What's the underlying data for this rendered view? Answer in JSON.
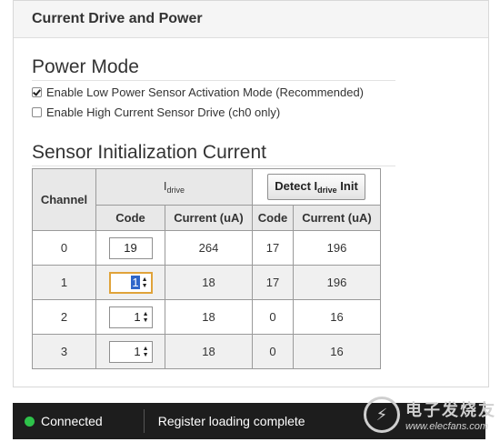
{
  "panel": {
    "title": "Current Drive and Power"
  },
  "power_mode": {
    "title": "Power Mode",
    "options": [
      {
        "label": "Enable Low Power Sensor Activation Mode (Recommended)",
        "checked": true
      },
      {
        "label": "Enable High Current Sensor Drive (ch0 only)",
        "checked": false
      }
    ]
  },
  "sensor_init": {
    "title": "Sensor Initialization Current",
    "table": {
      "channel_header": "Channel",
      "idrive_header": {
        "main": "I",
        "sub": "drive"
      },
      "detect_button": {
        "pre": "Detect I",
        "sub": "drive",
        "post": " Init"
      },
      "col_code": "Code",
      "col_current": "Current (uA)",
      "rows": [
        {
          "channel": "0",
          "code": "19",
          "current": "264",
          "detect_code": "17",
          "detect_current": "196"
        },
        {
          "channel": "1",
          "code": "1",
          "current": "18",
          "detect_code": "17",
          "detect_current": "196"
        },
        {
          "channel": "2",
          "code": "1",
          "current": "18",
          "detect_code": "0",
          "detect_current": "16"
        },
        {
          "channel": "3",
          "code": "1",
          "current": "18",
          "detect_code": "0",
          "detect_current": "16"
        }
      ]
    }
  },
  "status": {
    "connection": "Connected",
    "message": "Register loading complete"
  },
  "watermark": {
    "cn": "电子发烧友",
    "url": "www.elecfans.com"
  },
  "colors": {
    "connected": "#2ec24a",
    "statusbar_bg": "#1d1d1d",
    "focus": "#e0a33a"
  }
}
